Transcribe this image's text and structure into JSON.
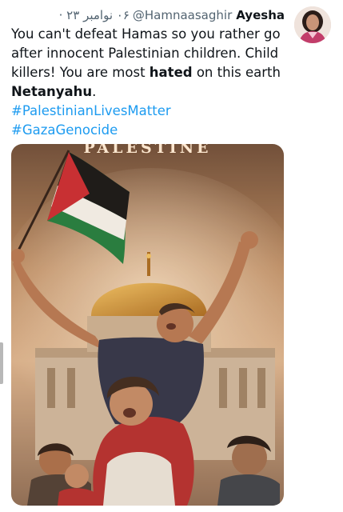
{
  "tweet": {
    "author_name": "Ayesha",
    "handle": "@Hamnaasaghir",
    "date": "۰۶ نوامبر ۲۳ ·",
    "text_line1": "You can't defeat Hamas so you rather go after innocent Palestinian children. Child killers! You are most ",
    "text_bold1": "hated",
    "text_line2": " on this earth ",
    "text_bold2": "Netanyahu",
    "text_end": ".",
    "hashtags": [
      "#PalestinianLivesMatter",
      "#GazaGenocide"
    ],
    "media": {
      "poster_title": "PALESTINE"
    }
  },
  "colors": {
    "text": "#0f1419",
    "secondary": "#536471",
    "link": "#1d9bf0",
    "flag_red": "#c8262d",
    "flag_green": "#1d7a3a",
    "dome_gold": "#d99a2e"
  }
}
